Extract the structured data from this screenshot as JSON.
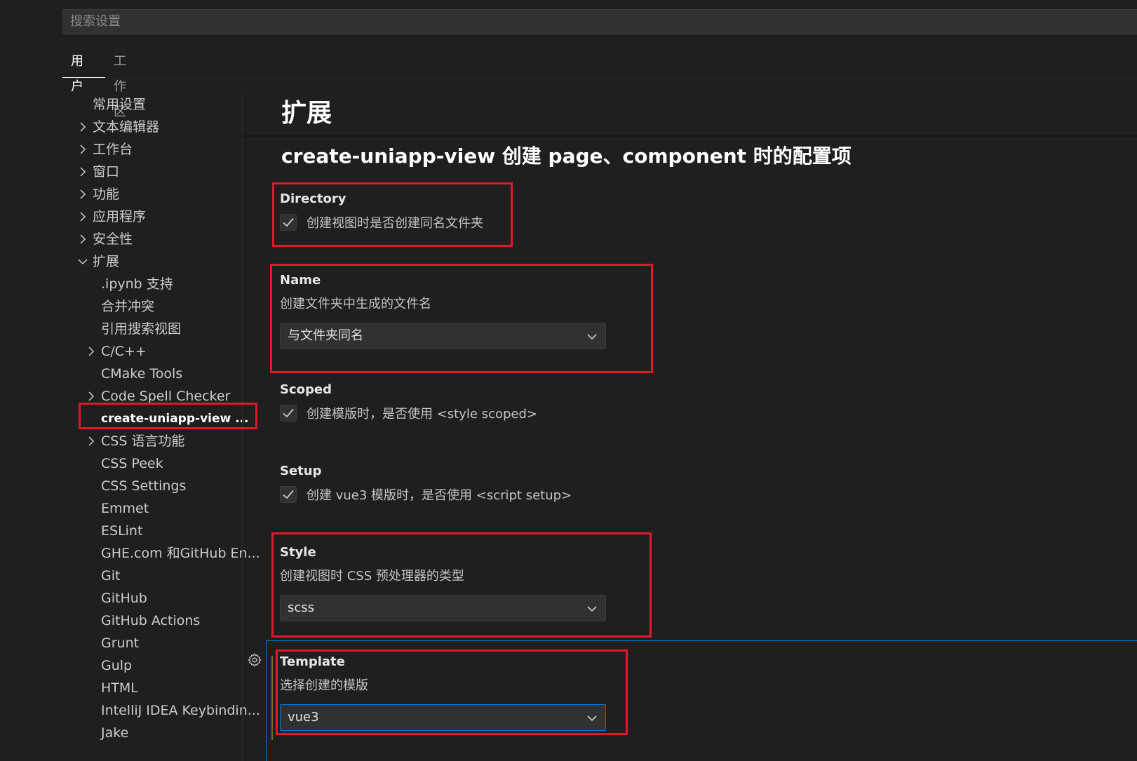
{
  "search": {
    "placeholder": "搜索设置"
  },
  "tabs": [
    {
      "label": "用户",
      "active": true
    },
    {
      "label": "工作区",
      "active": false
    }
  ],
  "toc": {
    "items": [
      {
        "label": "常用设置",
        "chevron": "none"
      },
      {
        "label": "文本编辑器",
        "chevron": "right"
      },
      {
        "label": "工作台",
        "chevron": "right"
      },
      {
        "label": "窗口",
        "chevron": "right"
      },
      {
        "label": "功能",
        "chevron": "right"
      },
      {
        "label": "应用程序",
        "chevron": "right"
      },
      {
        "label": "安全性",
        "chevron": "right"
      },
      {
        "label": "扩展",
        "chevron": "down"
      },
      {
        "label": ".ipynb 支持",
        "chevron": "none"
      },
      {
        "label": "合并冲突",
        "chevron": "none"
      },
      {
        "label": "引用搜索视图",
        "chevron": "none"
      },
      {
        "label": "C/C++",
        "chevron": "right"
      },
      {
        "label": "CMake Tools",
        "chevron": "none"
      },
      {
        "label": "Code Spell Checker",
        "chevron": "right"
      },
      {
        "label": "create-uniapp-view ...",
        "chevron": "none",
        "selected": true
      },
      {
        "label": "CSS 语言功能",
        "chevron": "right"
      },
      {
        "label": "CSS Peek",
        "chevron": "none"
      },
      {
        "label": "CSS Settings",
        "chevron": "none"
      },
      {
        "label": "Emmet",
        "chevron": "none"
      },
      {
        "label": "ESLint",
        "chevron": "none"
      },
      {
        "label": "GHE.com 和GitHub En...",
        "chevron": "none"
      },
      {
        "label": "Git",
        "chevron": "none"
      },
      {
        "label": "GitHub",
        "chevron": "none"
      },
      {
        "label": "GitHub Actions",
        "chevron": "none"
      },
      {
        "label": "Grunt",
        "chevron": "none"
      },
      {
        "label": "Gulp",
        "chevron": "none"
      },
      {
        "label": "HTML",
        "chevron": "none"
      },
      {
        "label": "IntelliJ IDEA Keybindin...",
        "chevron": "none"
      },
      {
        "label": "Jake",
        "chevron": "none"
      }
    ]
  },
  "content": {
    "page_title": "扩展",
    "section_title": "create-uniapp-view 创建 page、component 时的配置项",
    "settings": {
      "directory": {
        "name": "Directory",
        "checkbox_label": "创建视图时是否创建同名文件夹",
        "checked": true
      },
      "name": {
        "name": "Name",
        "description": "创建文件夹中生成的文件名",
        "value": "与文件夹同名"
      },
      "scoped": {
        "name": "Scoped",
        "checkbox_label": "创建模版时，是否使用 <style scoped>",
        "checked": true
      },
      "setup": {
        "name": "Setup",
        "checkbox_label": "创建 vue3 模版时，是否使用 <script setup>",
        "checked": true
      },
      "style": {
        "name": "Style",
        "description": "创建视图时 CSS 预处理器的类型",
        "value": "scss"
      },
      "template": {
        "name": "Template",
        "description": "选择创建的模版",
        "value": "vue3"
      }
    }
  },
  "colors": {
    "background": "#1f1f1f",
    "highlight_box": "#e0192a",
    "focus_border": "#0078d4"
  }
}
